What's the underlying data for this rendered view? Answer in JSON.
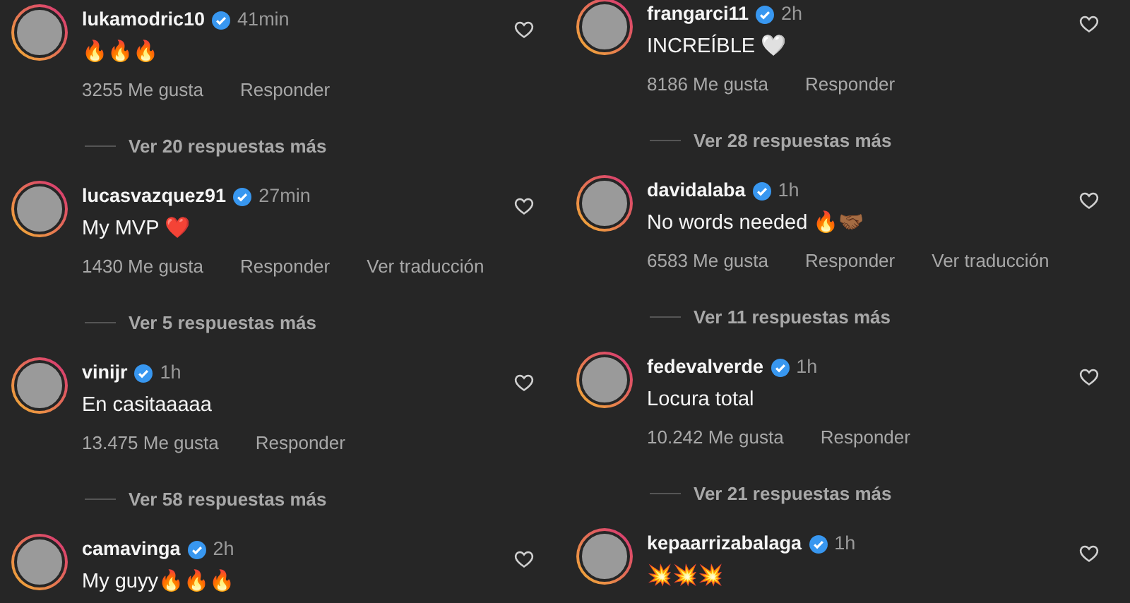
{
  "columns": [
    {
      "comments": [
        {
          "username": "lukamodric10",
          "verified": true,
          "time": "41min",
          "text": "🔥🔥🔥",
          "likes": "3255 Me gusta",
          "actions": [
            "Responder"
          ],
          "replies": "Ver 20 respuestas más",
          "liked": false
        },
        {
          "username": "lucasvazquez91",
          "verified": true,
          "time": "27min",
          "text": "My MVP ❤️",
          "likes": "1430 Me gusta",
          "actions": [
            "Responder",
            "Ver traducción"
          ],
          "replies": "Ver 5 respuestas más",
          "liked": false
        },
        {
          "username": "vinijr",
          "verified": true,
          "time": "1h",
          "text": "En casitaaaaa",
          "likes": "13.475 Me gusta",
          "actions": [
            "Responder"
          ],
          "replies": "Ver 58 respuestas más",
          "liked": false
        },
        {
          "username": "camavinga",
          "verified": true,
          "time": "2h",
          "text": "My guyy🔥🔥🔥",
          "liked": false
        }
      ]
    },
    {
      "comments": [
        {
          "username": "frangarci11",
          "verified": true,
          "time": "2h",
          "text": "INCREÍBLE 🤍",
          "likes": "8186 Me gusta",
          "actions": [
            "Responder"
          ],
          "replies": "Ver 28 respuestas más",
          "liked": false
        },
        {
          "username": "davidalaba",
          "verified": true,
          "time": "1h",
          "text": "No words needed 🔥🤝🏾",
          "likes": "6583 Me gusta",
          "actions": [
            "Responder",
            "Ver traducción"
          ],
          "replies": "Ver 11 respuestas más",
          "liked": false
        },
        {
          "username": "fedevalverde",
          "verified": true,
          "time": "1h",
          "text": "Locura total",
          "likes": "10.242 Me gusta",
          "actions": [
            "Responder"
          ],
          "replies": "Ver 21 respuestas más",
          "liked": false
        },
        {
          "username": "kepaarrizabalaga",
          "verified": true,
          "time": "1h",
          "text": "💥💥💥",
          "liked": false
        }
      ]
    }
  ]
}
